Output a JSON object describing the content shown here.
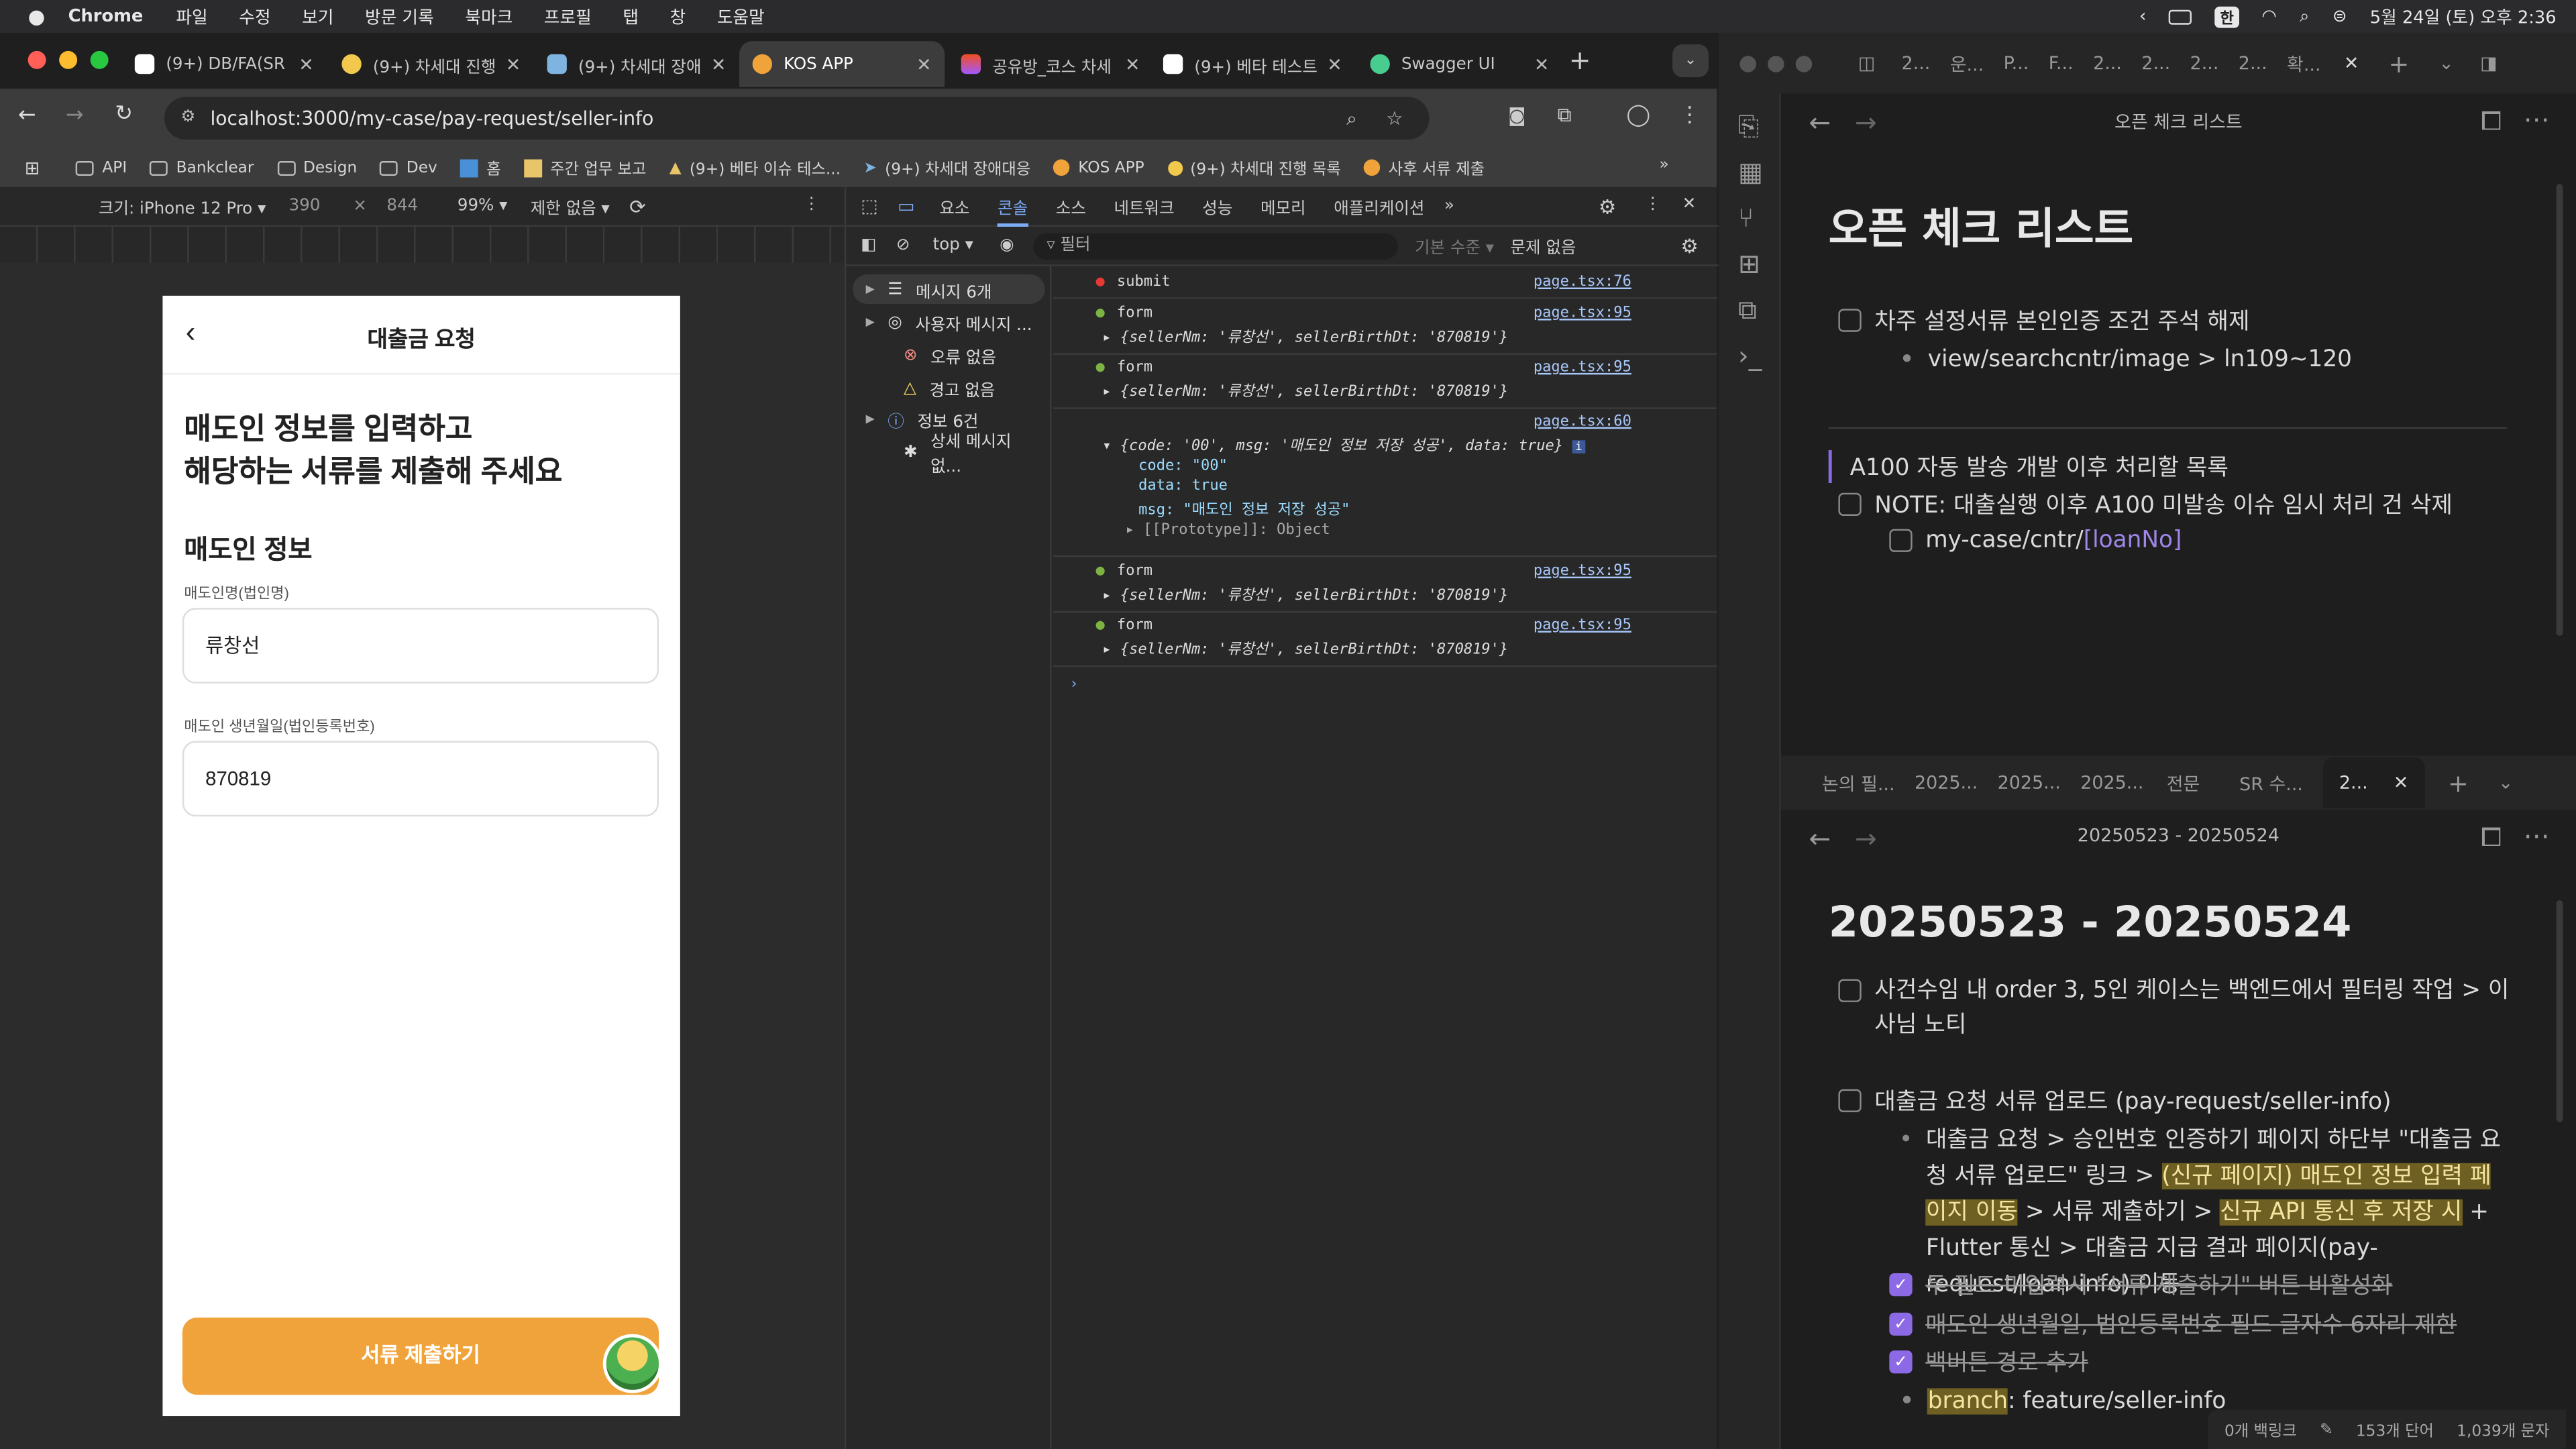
{
  "menubar": {
    "app": "Chrome",
    "items": [
      "파일",
      "수정",
      "보기",
      "방문 기록",
      "북마크",
      "프로필",
      "탭",
      "창",
      "도움말"
    ],
    "datetime": "5월 24일 (토) 오후 2:36",
    "input_mode": "한"
  },
  "chrome": {
    "tabs": [
      {
        "label": "(9+) DB/FA(SR"
      },
      {
        "label": "(9+) 차세대 진행"
      },
      {
        "label": "(9+) 차세대 장애"
      },
      {
        "label": "KOS APP"
      },
      {
        "label": "공유방_코스 차세"
      },
      {
        "label": "(9+) 베타 테스트"
      },
      {
        "label": "Swagger UI"
      }
    ],
    "url": "localhost:3000/my-case/pay-request/seller-info",
    "bookmarks": [
      "API",
      "Bankclear",
      "Design",
      "Dev",
      "홈",
      "주간 업무 보고",
      "(9+) 베타 이슈 테스...",
      "(9+) 차세대 장애대응",
      "KOS APP",
      "(9+) 차세대 진행 목록",
      "사후 서류 제출"
    ],
    "device": {
      "label": "크기: iPhone 12 Pro",
      "width": "390",
      "x": "×",
      "height": "844",
      "zoom": "99%",
      "throttle": "제한 없음"
    }
  },
  "app": {
    "header_title": "대출금 요청",
    "heading_line1": "매도인 정보를 입력하고",
    "heading_line2": "해당하는 서류를 제출해 주세요",
    "section_title": "매도인 정보",
    "field1_label": "매도인명(법인명)",
    "field1_value": "류창선",
    "field2_label": "매도인 생년월일(법인등록번호)",
    "field2_value": "870819",
    "submit_label": "서류 제출하기"
  },
  "devtools": {
    "tabs": [
      "요소",
      "콘솔",
      "소스",
      "네트워크",
      "성능",
      "메모리",
      "애플리케이션"
    ],
    "active_tab": "콘솔",
    "context": "top",
    "filter_placeholder": "필터",
    "level": "기본 수준",
    "issues": "문제 없음",
    "sidebar": [
      "메시지 6개",
      "사용자 메시지 ...",
      "오류 없음",
      "경고 없음",
      "정보 6건",
      "상세 메시지 없..."
    ],
    "logs": {
      "submit": {
        "text": "submit",
        "src": "page.tsx:76"
      },
      "form": "form",
      "form_src": "page.tsx:95",
      "form_obj": "{sellerNm: '류창선', sellerBirthDt: '870819'}",
      "resp_src": "page.tsx:60",
      "resp_summary": "{code: '00', msg: '매도인 정보 저장 성공', data: true}",
      "resp_code": "code: \"00\"",
      "resp_data": "data: true",
      "resp_msg": "msg: \"매도인 정보 저장 성공\"",
      "resp_proto": "[[Prototype]]: Object"
    }
  },
  "obsidian": {
    "top_tabs": [
      "2...",
      "운...",
      "P...",
      "F...",
      "2...",
      "2...",
      "2...",
      "2...",
      "확..."
    ],
    "pane1": {
      "title": "오픈 체크 리스트",
      "items": [
        {
          "text": "차주 설정서류 본인인증 조건 주석 해제"
        },
        {
          "text": "view/searchcntr/image > ln109~120"
        }
      ],
      "quote": "A100 자동 발송 개발 이후 처리할 목록",
      "note": "NOTE: 대출실행 이후 A100 미발송 이슈 임시 처리 건 삭제",
      "note_sub": "my-case/cntr/",
      "note_sub_link": "[loanNo]"
    },
    "pane2_tabs": [
      "논의 필...",
      "2025...",
      "2025...",
      "2025...",
      "전문",
      "SR 수...",
      "2..."
    ],
    "pane2": {
      "title": "20250523 - 20250524",
      "item1": "사건수임 내 order 3, 5인 케이스는 백엔드에서 필터링 작업 > 이사님 노티",
      "item2": "대출금 요청 서류 업로드 (pay-request/seller-info)",
      "desc_a": "대출금 요청 > 승인번호 인증하기 페이지 하단부 \"대출금 요청 서류 업로드\" 링크 > ",
      "desc_hl1": "(신규 페이지) 매도인 정보 입력 페이지 이동",
      "desc_b": " > 서류 제출하기 > ",
      "desc_hl2": "신규 API 통신 후 저장 시",
      "desc_c": " + Flutter 통신  > 대출금 지급 결과 페이지(pay-request/loan-info) 이동",
      "done1": "두 필드 미입력시 \"서류 제출하기\" 버튼 비활성화",
      "done2": "매도인 생년월일, 법인등록번호 필드 글자수 6자리 제한",
      "done3": "백버튼 경로 추가",
      "branch_label": "branch",
      "branch_value": ": feature/seller-info"
    },
    "status": {
      "backlinks": "0개 백링크",
      "words": "153개 단어",
      "chars": "1,039개 문자"
    }
  },
  "colors": {
    "accent": "#f0a33a",
    "obsidian_accent": "#8c6ae6",
    "link": "#a8c7fa"
  }
}
